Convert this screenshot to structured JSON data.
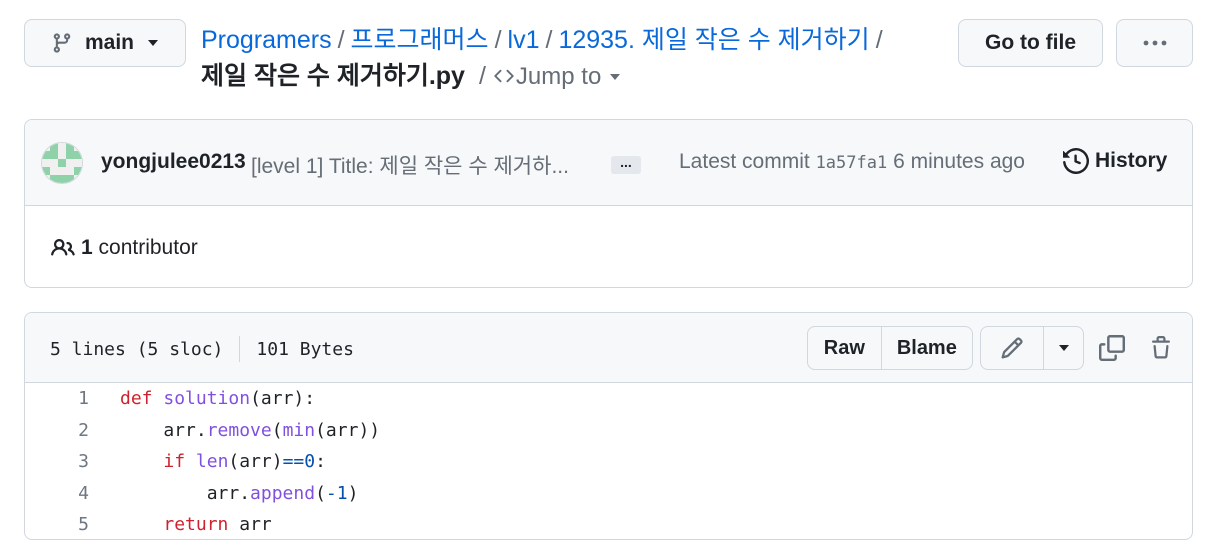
{
  "branch": {
    "name": "main"
  },
  "breadcrumb": {
    "items": [
      "Programers",
      "프로그래머스",
      "lv1",
      "12935. 제일 작은 수 제거하기"
    ],
    "separator": "/",
    "file": "제일 작은 수 제거하기.py",
    "jump_to": "Jump to"
  },
  "header_buttons": {
    "go_to_file": "Go to file",
    "more": "···"
  },
  "commit": {
    "author": "yongjulee0213",
    "message": "[level 1] Title: 제일 작은 수 제거하...",
    "ellipsis": "...",
    "latest_label": "Latest commit",
    "sha": "1a57fa1",
    "time": "6 minutes ago",
    "history_label": "History"
  },
  "contributors": {
    "count": "1",
    "label": "contributor"
  },
  "file_header": {
    "lines": "5 lines (5 sloc)",
    "size": "101 Bytes",
    "raw": "Raw",
    "blame": "Blame"
  },
  "code": {
    "line_numbers": [
      "1",
      "2",
      "3",
      "4",
      "5"
    ],
    "lines": [
      [
        {
          "t": "def",
          "c": "kw"
        },
        {
          "t": " "
        },
        {
          "t": "solution",
          "c": "fn"
        },
        {
          "t": "(arr):"
        }
      ],
      [
        {
          "t": "    arr."
        },
        {
          "t": "remove",
          "c": "fn"
        },
        {
          "t": "("
        },
        {
          "t": "min",
          "c": "fn"
        },
        {
          "t": "(arr))"
        }
      ],
      [
        {
          "t": "    "
        },
        {
          "t": "if",
          "c": "kw"
        },
        {
          "t": " "
        },
        {
          "t": "len",
          "c": "fn"
        },
        {
          "t": "(arr)"
        },
        {
          "t": "==",
          "c": "op"
        },
        {
          "t": "0",
          "c": "num"
        },
        {
          "t": ":"
        }
      ],
      [
        {
          "t": "        arr."
        },
        {
          "t": "append",
          "c": "fn"
        },
        {
          "t": "("
        },
        {
          "t": "-1",
          "c": "num"
        },
        {
          "t": ")"
        }
      ],
      [
        {
          "t": "    "
        },
        {
          "t": "return",
          "c": "kw"
        },
        {
          "t": " arr"
        }
      ]
    ]
  },
  "colors": {
    "link": "#0969da",
    "keyword": "#cf222e",
    "function": "#8250df",
    "number": "#0550ae",
    "border": "#d0d7de"
  },
  "icons": [
    "git-branch-icon",
    "code-icon",
    "history-icon",
    "people-icon",
    "pencil-icon",
    "copy-icon",
    "trash-icon",
    "kebab-icon"
  ]
}
